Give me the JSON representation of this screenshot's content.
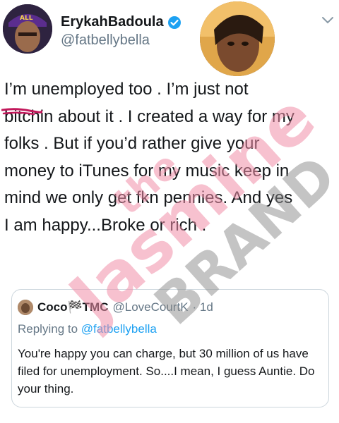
{
  "tweet": {
    "display_name": "ErykahBadoula",
    "handle": "@fatbellybella",
    "icons": {
      "verified": "verified-badge-icon",
      "more": "chevron-down-icon"
    },
    "text_lines": [
      "I’m unemployed too . I’m just not",
      "bitchin about it . I created a way for my",
      "folks . But if you’d rather give your",
      "money to iTunes for my music keep in",
      "mind we only get fkn pennies. And yes",
      "I am happy...Broke or rich ."
    ]
  },
  "quoted": {
    "name": "Coco🏁TMC",
    "handle": "@LoveCourtK",
    "time": "· 1d",
    "replying_prefix": "Replying to",
    "replying_to": "@fatbellybella",
    "text": "You're happy you can charge, but 30 million of us have filed for unemployment. So....I mean, I guess Auntie. Do your thing."
  },
  "watermark": {
    "line1": "the",
    "line2": "Jasmine",
    "line3": "BRAND"
  },
  "colors": {
    "accent": "#1da1f2",
    "secondary_text": "#657786",
    "border": "#ccd6dd",
    "watermark_pink": "#f08ea8",
    "censor": "#c2185b"
  }
}
